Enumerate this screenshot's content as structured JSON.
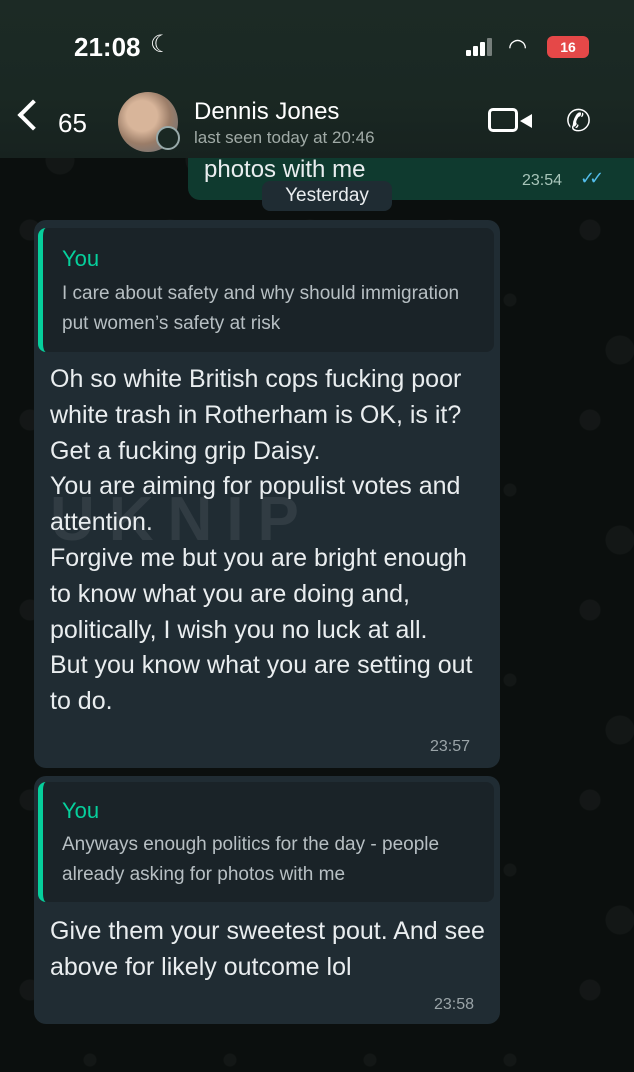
{
  "status_bar": {
    "time": "21:08",
    "battery": "16"
  },
  "header": {
    "back_count": "65",
    "contact_name": "Dennis Jones",
    "last_seen": "last seen today at 20:46"
  },
  "previous_message": {
    "text": "photos with me",
    "time": "23:54"
  },
  "date_divider": "Yesterday",
  "messages": [
    {
      "quote_author": "You",
      "quote_text": "I care about safety and why should immigration put women’s safety at risk",
      "text": "Oh so white British cops fucking poor white trash in Rotherham is OK, is it? Get a fucking grip Daisy.\nYou are aiming for populist votes and attention.\nForgive me but you are bright enough to know what you are doing and, politically, I wish you no luck at all.\nBut you know what you are setting out to do.",
      "time": "23:57"
    },
    {
      "quote_author": "You",
      "quote_text": "Anyways enough politics for the day - people already asking for photos with me",
      "text": "Give them your sweetest pout. And see above for likely outcome lol",
      "time": "23:58"
    }
  ],
  "watermark": "UKNIP",
  "colors": {
    "header_bg": "#1a2823",
    "incoming_bubble": "#202c33",
    "quote_accent": "#06cf9c",
    "read_ticks": "#53bdeb"
  }
}
